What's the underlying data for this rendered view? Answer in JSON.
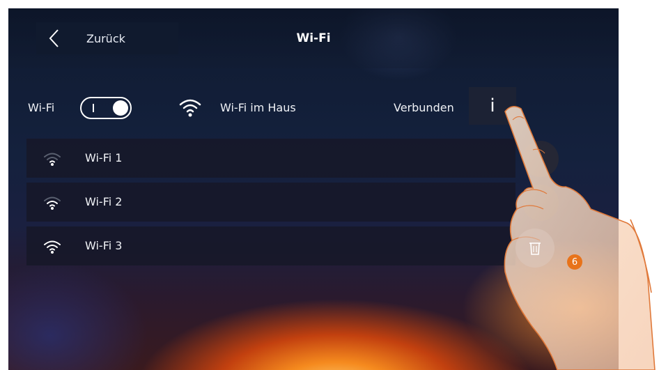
{
  "header": {
    "back_label": "Zurück",
    "title": "Wi-Fi",
    "back_icon": "chevron-left-icon"
  },
  "wifi_row": {
    "label": "Wi-Fi",
    "toggle_state": "on",
    "toggle_mark": "I",
    "network_name": "Wi-Fi im Haus",
    "network_icon": "wifi-icon",
    "status": "Verbunden",
    "info_label": "i"
  },
  "networks": [
    {
      "label": "Wi-Fi 1",
      "icon": "wifi-signal-low-icon"
    },
    {
      "label": "Wi-Fi 2",
      "icon": "wifi-signal-medium-icon"
    },
    {
      "label": "Wi-Fi 3",
      "icon": "wifi-signal-full-icon"
    }
  ],
  "delete_icon": "trash-icon",
  "step_badge": "6",
  "colors": {
    "accent_badge": "#e8731a",
    "button_bg": "#101a2e",
    "list_bg": "#16182a"
  }
}
